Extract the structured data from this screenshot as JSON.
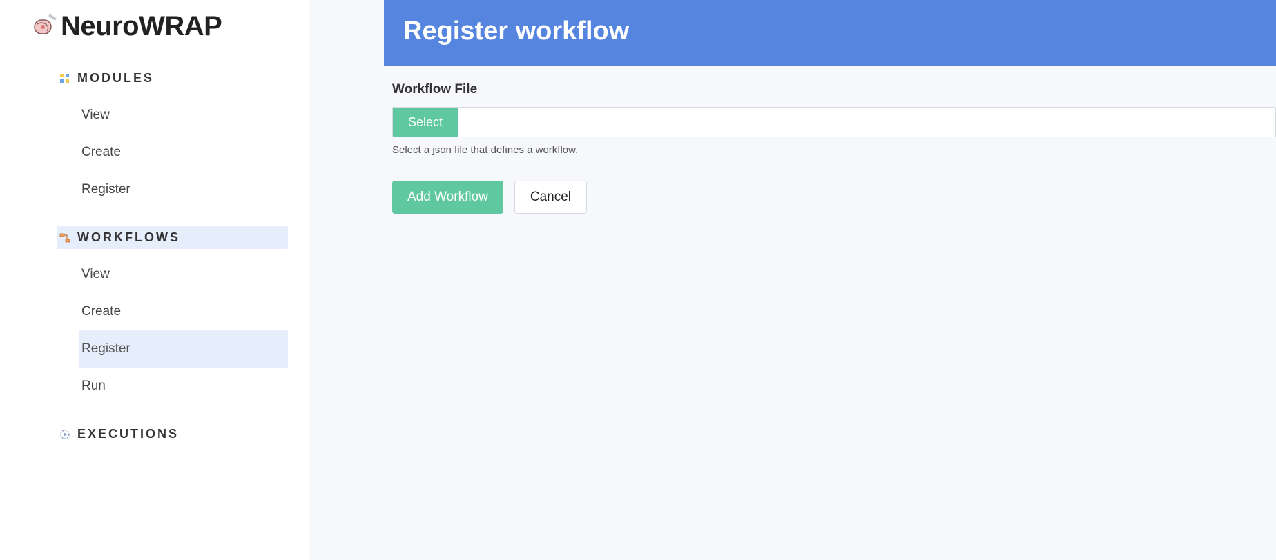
{
  "app": {
    "name": "NeuroWRAP"
  },
  "sidebar": {
    "sections": [
      {
        "label": "MODULES",
        "items": [
          {
            "label": "View"
          },
          {
            "label": "Create"
          },
          {
            "label": "Register"
          }
        ]
      },
      {
        "label": "WORKFLOWS",
        "items": [
          {
            "label": "View"
          },
          {
            "label": "Create"
          },
          {
            "label": "Register"
          },
          {
            "label": "Run"
          }
        ]
      },
      {
        "label": "EXECUTIONS",
        "items": []
      }
    ]
  },
  "page": {
    "title": "Register workflow",
    "file_label": "Workflow File",
    "select_btn": "Select",
    "helper": "Select a json file that defines a workflow.",
    "add_btn": "Add Workflow",
    "cancel_btn": "Cancel"
  }
}
